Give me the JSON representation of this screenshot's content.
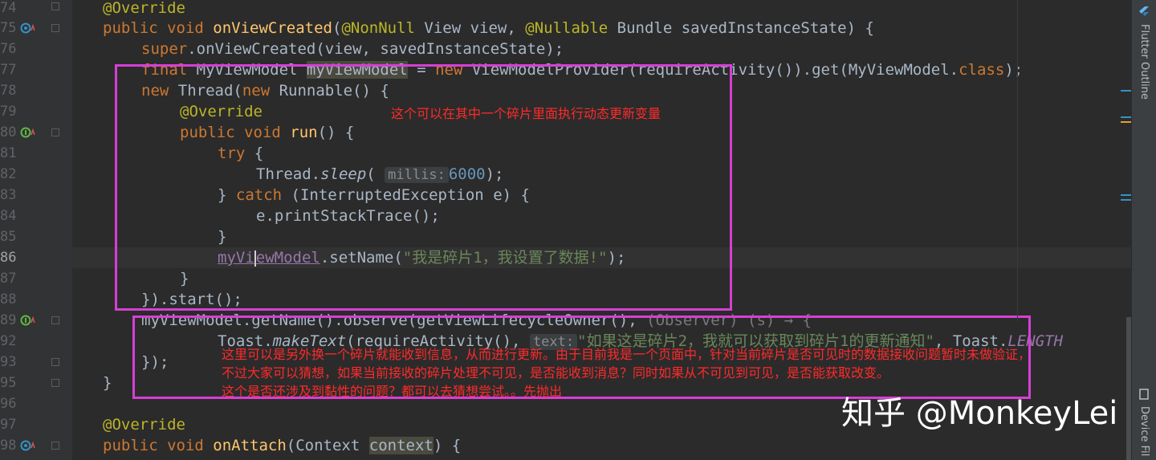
{
  "gutter": {
    "line_numbers": [
      "74",
      "75",
      "76",
      "77",
      "78",
      "79",
      "80",
      "81",
      "82",
      "83",
      "84",
      "85",
      "86",
      "87",
      "88",
      "89",
      "92",
      "93",
      "95",
      "96",
      "97",
      "98"
    ]
  },
  "code": {
    "l74": "@Override",
    "l75_kw": "public void ",
    "l75_fn": "onViewCreated",
    "l75_p1": "(",
    "l75_an1": "@NonNull",
    "l75_p2": " View view, ",
    "l75_an2": "@Nullable",
    "l75_p3": " Bundle savedInstanceState) {",
    "l76_kw": "super",
    "l76_rest": ".onViewCreated(view, savedInstanceState);",
    "l77_kw": "final",
    "l77_a": " MyViewModel ",
    "l77_var": "myViewModel",
    "l77_b": " = ",
    "l77_kw2": "new",
    "l77_c": " ViewModelProvider(requireActivity()).get(MyViewModel.",
    "l77_kw3": "class",
    "l77_d": ");",
    "l78_kw": "new",
    "l78_a": " Thread(",
    "l78_kw2": "new",
    "l78_b": " Runnable() {",
    "l79": "@Override",
    "l80_kw": "public void ",
    "l80_fn": "run",
    "l80_rest": "() {",
    "l81_kw": "try",
    "l81_rest": " {",
    "l82_a": "Thread.",
    "l82_it": "sleep",
    "l82_b": "( ",
    "l82_hint": "millis:",
    "l82_num": "6000",
    "l82_c": ");",
    "l83_a": "} ",
    "l83_kw": "catch",
    "l83_b": " (InterruptedException e) {",
    "l84": "e.printStackTrace();",
    "l85": "}",
    "l86_var1": "myVi",
    "l86_var2": "ewModel",
    "l86_a": ".setName(",
    "l86_str": "\"我是碎片1，我设置了数据!\"",
    "l86_b": ");",
    "l87": "}",
    "l88": "}).start();",
    "l89_var": "myViewModel",
    "l89_a": ".getName().observe(getViewLifecycleOwner(), ",
    "l89_gray": "(Observer) (s) → {",
    "l92_a": "Toast.",
    "l92_it": "makeText",
    "l92_b": "(requireActivity(), ",
    "l92_hint": "text:",
    "l92_str": "\"如果这是碎片2，我就可以获取到碎片1的更新通知\"",
    "l92_c": ", Toast.",
    "l92_fld": "LENGTH",
    "l93": "});",
    "l95": "}",
    "l97": "@Override",
    "l98_kw": "public void ",
    "l98_fn": "onAttach",
    "l98_a": "(Context ",
    "l98_ctx": "context",
    "l98_b": ") {"
  },
  "annotations": {
    "note1": "这个可以在其中一个碎片里面执行动态更新变量",
    "note2_line1": "这里可以是另外换一个碎片就能收到信息，从而进行更新。由于目前我是一个页面中，针对当前碎片是否可见时的数据接收问题暂时未做验证，",
    "note2_line2": "不过大家可以猜想，如果当前接收的碎片处理不可见，是否能收到消息？同时如果从不可见到可见，是否能获取改变。",
    "note2_line3": "这个是否还涉及到黏性的问题？都可以去猜想尝试。。先抛出"
  },
  "right_panel": {
    "flutter_outline": "Flutter Outline",
    "device_file": "Device Fil"
  },
  "watermark": "知乎 @MonkeyLei",
  "colors": {
    "background": "#2b2b2b",
    "keyword": "#cc7832",
    "annotation": "#bbb529",
    "function": "#ffc66d",
    "string": "#6a8759",
    "number": "#6897bb",
    "field": "#9876aa",
    "box_border": "#d63fd6",
    "note_text": "#ff2a2a"
  }
}
